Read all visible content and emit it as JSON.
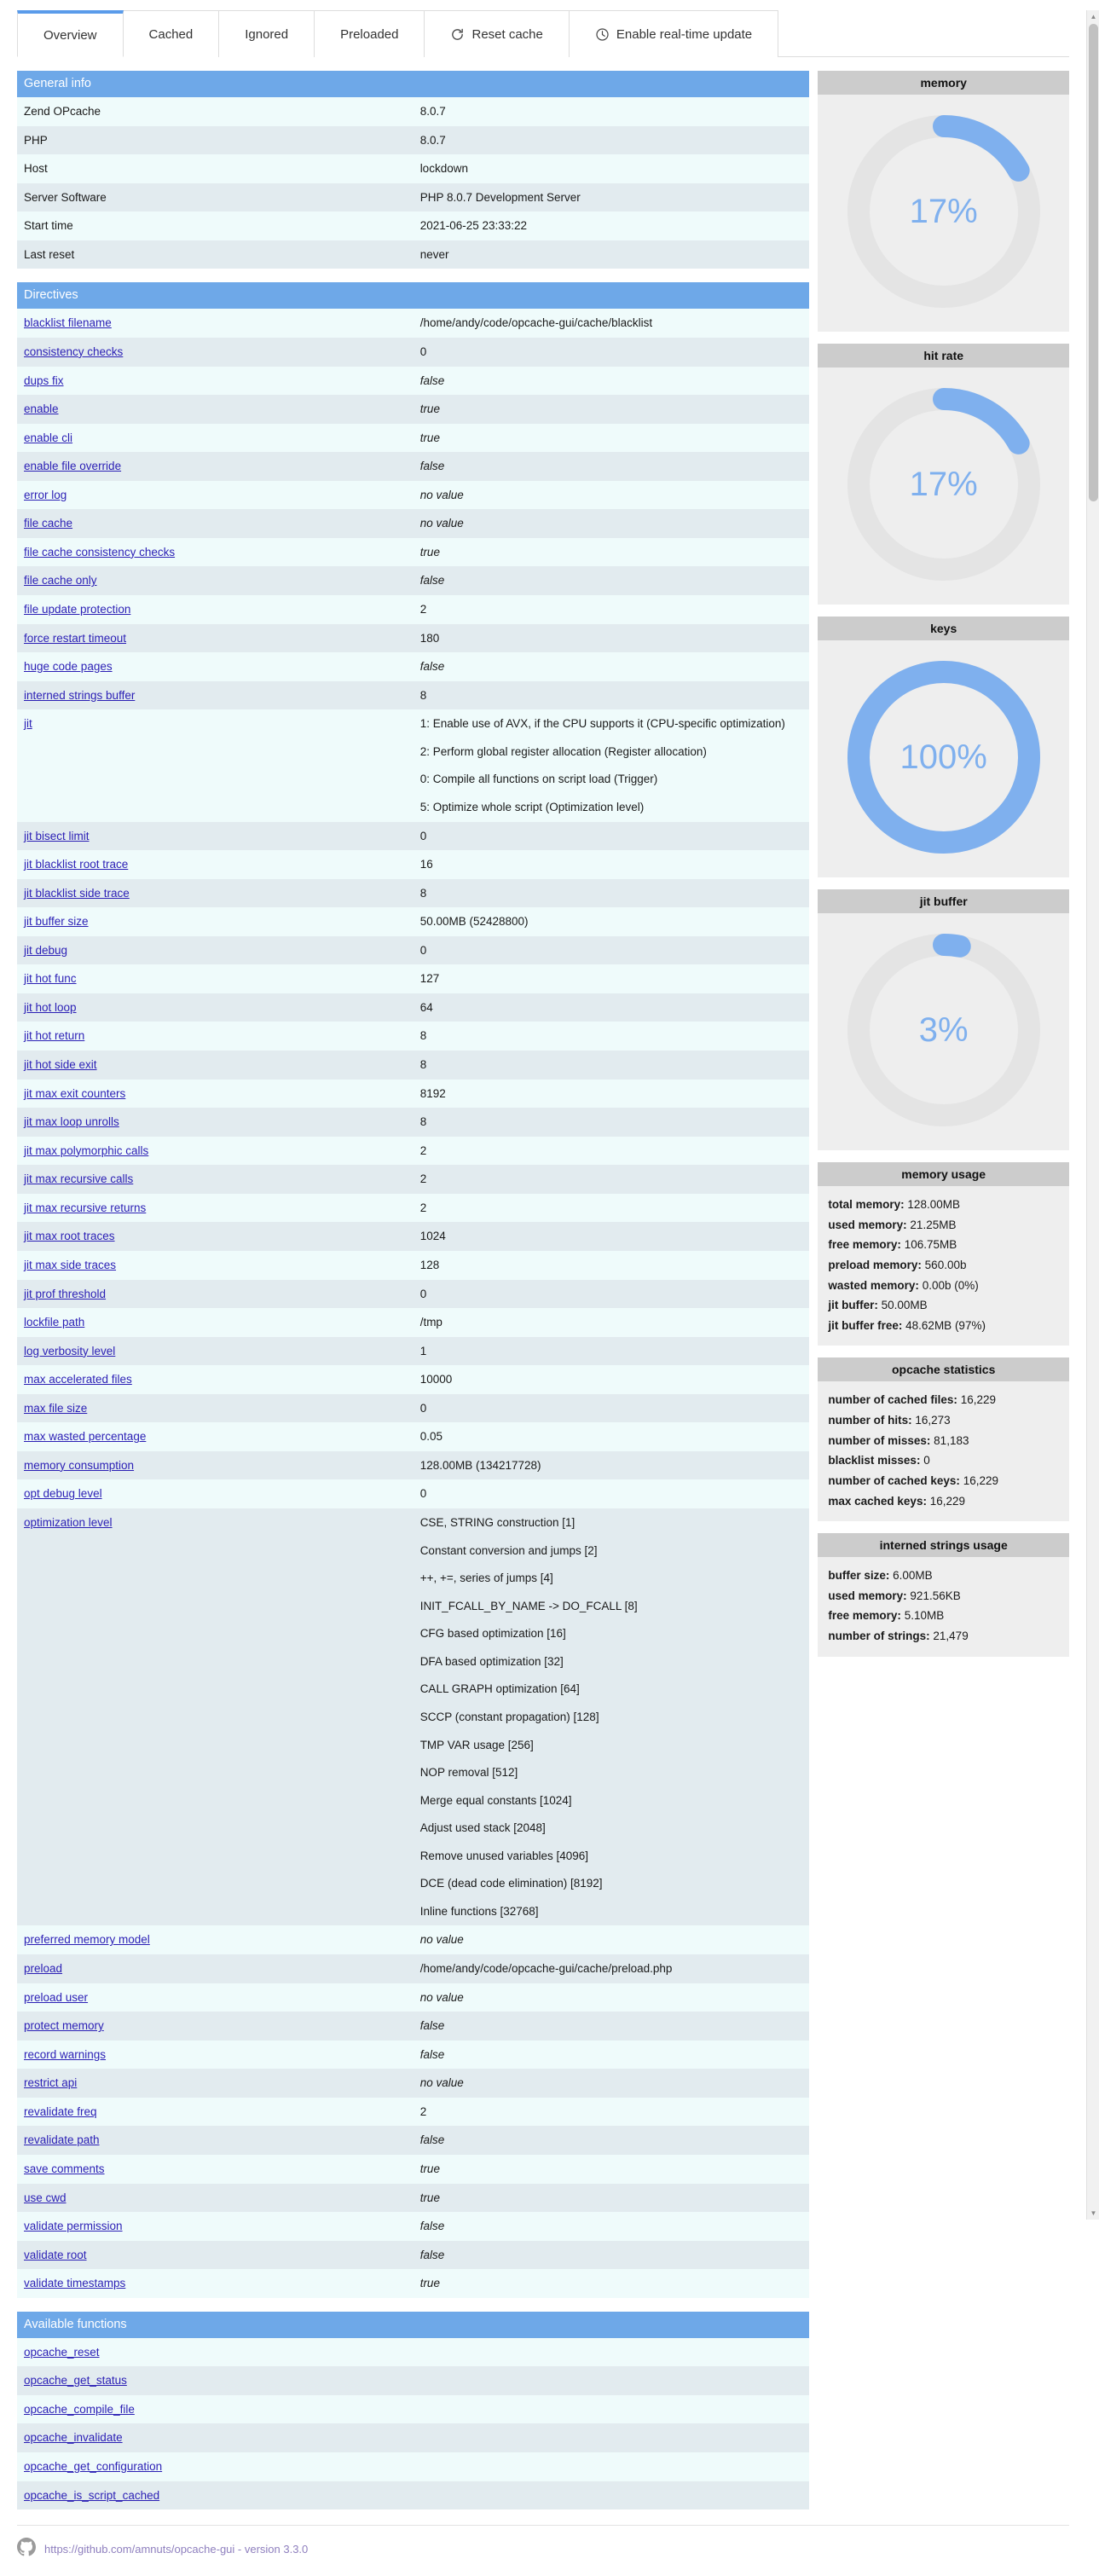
{
  "tabs": [
    {
      "label": "Overview",
      "icon": null,
      "active": true
    },
    {
      "label": "Cached",
      "icon": null,
      "active": false
    },
    {
      "label": "Ignored",
      "icon": null,
      "active": false
    },
    {
      "label": "Preloaded",
      "icon": null,
      "active": false
    },
    {
      "label": "Reset cache",
      "icon": "refresh-icon",
      "active": false
    },
    {
      "label": "Enable real-time update",
      "icon": "clock-icon",
      "active": false
    }
  ],
  "sections": {
    "general": {
      "title": "General info",
      "rows": [
        {
          "key": "Zend OPcache",
          "value": "8.0.7",
          "link": false,
          "italic": false
        },
        {
          "key": "PHP",
          "value": "8.0.7",
          "link": false,
          "italic": false
        },
        {
          "key": "Host",
          "value": "lockdown",
          "link": false,
          "italic": false
        },
        {
          "key": "Server Software",
          "value": "PHP 8.0.7 Development Server",
          "link": false,
          "italic": false
        },
        {
          "key": "Start time",
          "value": "2021-06-25 23:33:22",
          "link": false,
          "italic": false
        },
        {
          "key": "Last reset",
          "value": "never",
          "link": false,
          "italic": false
        }
      ]
    },
    "directives": {
      "title": "Directives",
      "rows": [
        {
          "key": "blacklist filename",
          "value": "/home/andy/code/opcache-gui/cache/blacklist",
          "link": true,
          "italic": false
        },
        {
          "key": "consistency checks",
          "value": "0",
          "link": true,
          "italic": false
        },
        {
          "key": "dups fix",
          "value": "false",
          "link": true,
          "italic": true
        },
        {
          "key": "enable",
          "value": "true",
          "link": true,
          "italic": true
        },
        {
          "key": "enable cli",
          "value": "true",
          "link": true,
          "italic": true
        },
        {
          "key": "enable file override",
          "value": "false",
          "link": true,
          "italic": true
        },
        {
          "key": "error log",
          "value": "no value",
          "link": true,
          "italic": true
        },
        {
          "key": "file cache",
          "value": "no value",
          "link": true,
          "italic": true
        },
        {
          "key": "file cache consistency checks",
          "value": "true",
          "link": true,
          "italic": true
        },
        {
          "key": "file cache only",
          "value": "false",
          "link": true,
          "italic": true
        },
        {
          "key": "file update protection",
          "value": "2",
          "link": true,
          "italic": false
        },
        {
          "key": "force restart timeout",
          "value": "180",
          "link": true,
          "italic": false
        },
        {
          "key": "huge code pages",
          "value": "false",
          "link": true,
          "italic": true
        },
        {
          "key": "interned strings buffer",
          "value": "8",
          "link": true,
          "italic": false
        },
        {
          "key": "jit",
          "link": true,
          "italic": false,
          "lines": [
            "1: Enable use of AVX, if the CPU supports it (CPU-specific optimization)",
            "2: Perform global register allocation (Register allocation)",
            "0: Compile all functions on script load (Trigger)",
            "5: Optimize whole script (Optimization level)"
          ]
        },
        {
          "key": "jit bisect limit",
          "value": "0",
          "link": true,
          "italic": false
        },
        {
          "key": "jit blacklist root trace",
          "value": "16",
          "link": true,
          "italic": false
        },
        {
          "key": "jit blacklist side trace",
          "value": "8",
          "link": true,
          "italic": false
        },
        {
          "key": "jit buffer size",
          "value": "50.00MB (52428800)",
          "link": true,
          "italic": false
        },
        {
          "key": "jit debug",
          "value": "0",
          "link": true,
          "italic": false
        },
        {
          "key": "jit hot func",
          "value": "127",
          "link": true,
          "italic": false
        },
        {
          "key": "jit hot loop",
          "value": "64",
          "link": true,
          "italic": false
        },
        {
          "key": "jit hot return",
          "value": "8",
          "link": true,
          "italic": false
        },
        {
          "key": "jit hot side exit",
          "value": "8",
          "link": true,
          "italic": false
        },
        {
          "key": "jit max exit counters",
          "value": "8192",
          "link": true,
          "italic": false
        },
        {
          "key": "jit max loop unrolls",
          "value": "8",
          "link": true,
          "italic": false
        },
        {
          "key": "jit max polymorphic calls",
          "value": "2",
          "link": true,
          "italic": false
        },
        {
          "key": "jit max recursive calls",
          "value": "2",
          "link": true,
          "italic": false
        },
        {
          "key": "jit max recursive returns",
          "value": "2",
          "link": true,
          "italic": false
        },
        {
          "key": "jit max root traces",
          "value": "1024",
          "link": true,
          "italic": false
        },
        {
          "key": "jit max side traces",
          "value": "128",
          "link": true,
          "italic": false
        },
        {
          "key": "jit prof threshold",
          "value": "0",
          "link": true,
          "italic": false
        },
        {
          "key": "lockfile path",
          "value": "/tmp",
          "link": true,
          "italic": false
        },
        {
          "key": "log verbosity level",
          "value": "1",
          "link": true,
          "italic": false
        },
        {
          "key": "max accelerated files",
          "value": "10000",
          "link": true,
          "italic": false
        },
        {
          "key": "max file size",
          "value": "0",
          "link": true,
          "italic": false
        },
        {
          "key": "max wasted percentage",
          "value": "0.05",
          "link": true,
          "italic": false
        },
        {
          "key": "memory consumption",
          "value": "128.00MB (134217728)",
          "link": true,
          "italic": false
        },
        {
          "key": "opt debug level",
          "value": "0",
          "link": true,
          "italic": false
        },
        {
          "key": "optimization level",
          "link": true,
          "italic": false,
          "lines": [
            "CSE, STRING construction [1]",
            "Constant conversion and jumps [2]",
            "++, +=, series of jumps [4]",
            "INIT_FCALL_BY_NAME -> DO_FCALL [8]",
            "CFG based optimization [16]",
            "DFA based optimization [32]",
            "CALL GRAPH optimization [64]",
            "SCCP (constant propagation) [128]",
            "TMP VAR usage [256]",
            "NOP removal [512]",
            "Merge equal constants [1024]",
            "Adjust used stack [2048]",
            "Remove unused variables [4096]",
            "DCE (dead code elimination) [8192]",
            "Inline functions [32768]"
          ]
        },
        {
          "key": "preferred memory model",
          "value": "no value",
          "link": true,
          "italic": true
        },
        {
          "key": "preload",
          "value": "/home/andy/code/opcache-gui/cache/preload.php",
          "link": true,
          "italic": false
        },
        {
          "key": "preload user",
          "value": "no value",
          "link": true,
          "italic": true
        },
        {
          "key": "protect memory",
          "value": "false",
          "link": true,
          "italic": true
        },
        {
          "key": "record warnings",
          "value": "false",
          "link": true,
          "italic": true
        },
        {
          "key": "restrict api",
          "value": "no value",
          "link": true,
          "italic": true
        },
        {
          "key": "revalidate freq",
          "value": "2",
          "link": true,
          "italic": false
        },
        {
          "key": "revalidate path",
          "value": "false",
          "link": true,
          "italic": true
        },
        {
          "key": "save comments",
          "value": "true",
          "link": true,
          "italic": true
        },
        {
          "key": "use cwd",
          "value": "true",
          "link": true,
          "italic": true
        },
        {
          "key": "validate permission",
          "value": "false",
          "link": true,
          "italic": true
        },
        {
          "key": "validate root",
          "value": "false",
          "link": true,
          "italic": true
        },
        {
          "key": "validate timestamps",
          "value": "true",
          "link": true,
          "italic": true
        }
      ]
    },
    "functions": {
      "title": "Available functions",
      "items": [
        "opcache_reset",
        "opcache_get_status",
        "opcache_compile_file",
        "opcache_invalidate",
        "opcache_get_configuration",
        "opcache_is_script_cached"
      ]
    }
  },
  "gauges": [
    {
      "title": "memory",
      "percent": 17,
      "label": "17%",
      "size": "large"
    },
    {
      "title": "hit rate",
      "percent": 17,
      "label": "17%",
      "size": "large"
    },
    {
      "title": "keys",
      "percent": 100,
      "label": "100%",
      "size": "large"
    },
    {
      "title": "jit buffer",
      "percent": 3,
      "label": "3%",
      "size": "large"
    }
  ],
  "panels": [
    {
      "title": "memory usage",
      "stats": [
        {
          "label": "total memory:",
          "value": "128.00MB"
        },
        {
          "label": "used memory:",
          "value": "21.25MB"
        },
        {
          "label": "free memory:",
          "value": "106.75MB"
        },
        {
          "label": "preload memory:",
          "value": "560.00b"
        },
        {
          "label": "wasted memory:",
          "value": "0.00b (0%)"
        },
        {
          "label": "jit buffer:",
          "value": "50.00MB"
        },
        {
          "label": "jit buffer free:",
          "value": "48.62MB (97%)"
        }
      ]
    },
    {
      "title": "opcache statistics",
      "stats": [
        {
          "label": "number of cached files:",
          "value": "16,229"
        },
        {
          "label": "number of hits:",
          "value": "16,273"
        },
        {
          "label": "number of misses:",
          "value": "81,183"
        },
        {
          "label": "blacklist misses:",
          "value": "0"
        },
        {
          "label": "number of cached keys:",
          "value": "16,229"
        },
        {
          "label": "max cached keys:",
          "value": "16,229"
        }
      ]
    },
    {
      "title": "interned strings usage",
      "stats": [
        {
          "label": "buffer size:",
          "value": "6.00MB"
        },
        {
          "label": "used memory:",
          "value": "921.56KB"
        },
        {
          "label": "free memory:",
          "value": "5.10MB"
        },
        {
          "label": "number of strings:",
          "value": "21,479"
        }
      ]
    }
  ],
  "footer": {
    "link_text": "https://github.com/amnuts/opcache-gui - version 3.3.0",
    "icon": "github-icon"
  },
  "colors": {
    "accent": "#6ea8e8",
    "gauge_fill": "#7fb0ee",
    "gauge_track": "#e4e4e4",
    "panel_header": "#cccccc",
    "row_odd": "#effbfb",
    "row_even": "#e2ebef",
    "link": "#2b1fb5",
    "footer_link": "#8e7fbe"
  }
}
